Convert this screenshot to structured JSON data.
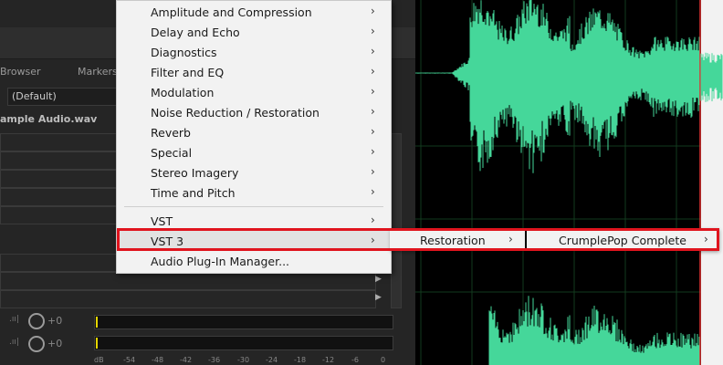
{
  "left_panel": {
    "tab_media_browser": "Browser",
    "tab_markers": "Markers",
    "preset_value": "(Default)",
    "file_name": "ample Audio.wav",
    "channel_gain_1": "+0",
    "channel_gain_2": "+0",
    "meter_scale": [
      "dB",
      "-54",
      "-48",
      "-42",
      "-36",
      "-30",
      "-24",
      "-18",
      "-12",
      "-6",
      "0"
    ]
  },
  "menu": {
    "items": [
      {
        "label": "Amplitude and Compression",
        "arrow": "›"
      },
      {
        "label": "Delay and Echo",
        "arrow": "›"
      },
      {
        "label": "Diagnostics",
        "arrow": "›"
      },
      {
        "label": "Filter and EQ",
        "arrow": "›"
      },
      {
        "label": "Modulation",
        "arrow": "›"
      },
      {
        "label": "Noise Reduction / Restoration",
        "arrow": "›"
      },
      {
        "label": "Reverb",
        "arrow": "›"
      },
      {
        "label": "Special",
        "arrow": "›"
      },
      {
        "label": "Stereo Imagery",
        "arrow": "›"
      },
      {
        "label": "Time and Pitch",
        "arrow": "›"
      },
      {
        "label": "VST",
        "arrow": "›"
      },
      {
        "label": "VST 3",
        "arrow": "›"
      },
      {
        "label": "Audio Plug-In Manager...",
        "arrow": ""
      }
    ],
    "submenu_1": {
      "label": "Restoration",
      "arrow": "›"
    },
    "submenu_2": {
      "label": "CrumplePop Complete",
      "arrow": "›"
    }
  },
  "colors": {
    "waveform": "#45d79a",
    "highlight_box": "#e0141e",
    "playhead": "#e03030"
  }
}
